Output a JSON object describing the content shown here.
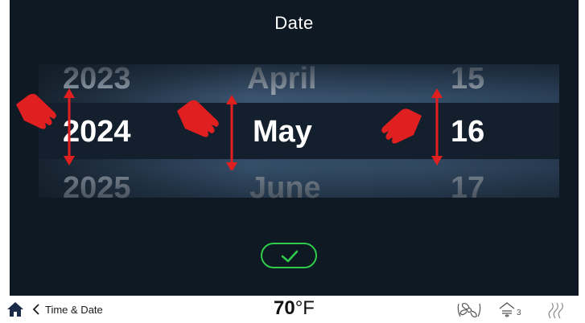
{
  "title": "Date",
  "picker": {
    "year": {
      "prev": "2023",
      "current": "2024",
      "next": "2025"
    },
    "month": {
      "prev": "April",
      "current": "May",
      "next": "June"
    },
    "day": {
      "prev": "15",
      "current": "16",
      "next": "17"
    }
  },
  "confirm": {
    "icon": "checkmark-icon"
  },
  "statusbar": {
    "home_icon": "home-icon",
    "back_label": "Time & Date",
    "temperature": "70",
    "temperature_unit": "°F",
    "status_icons": [
      "fan-icon",
      "heat-level-icon",
      "steam-icon"
    ],
    "heat_level": "3"
  },
  "colors": {
    "background": "#0f1923",
    "accent_green": "#2fcc4a",
    "annotation_red": "#e02020"
  }
}
